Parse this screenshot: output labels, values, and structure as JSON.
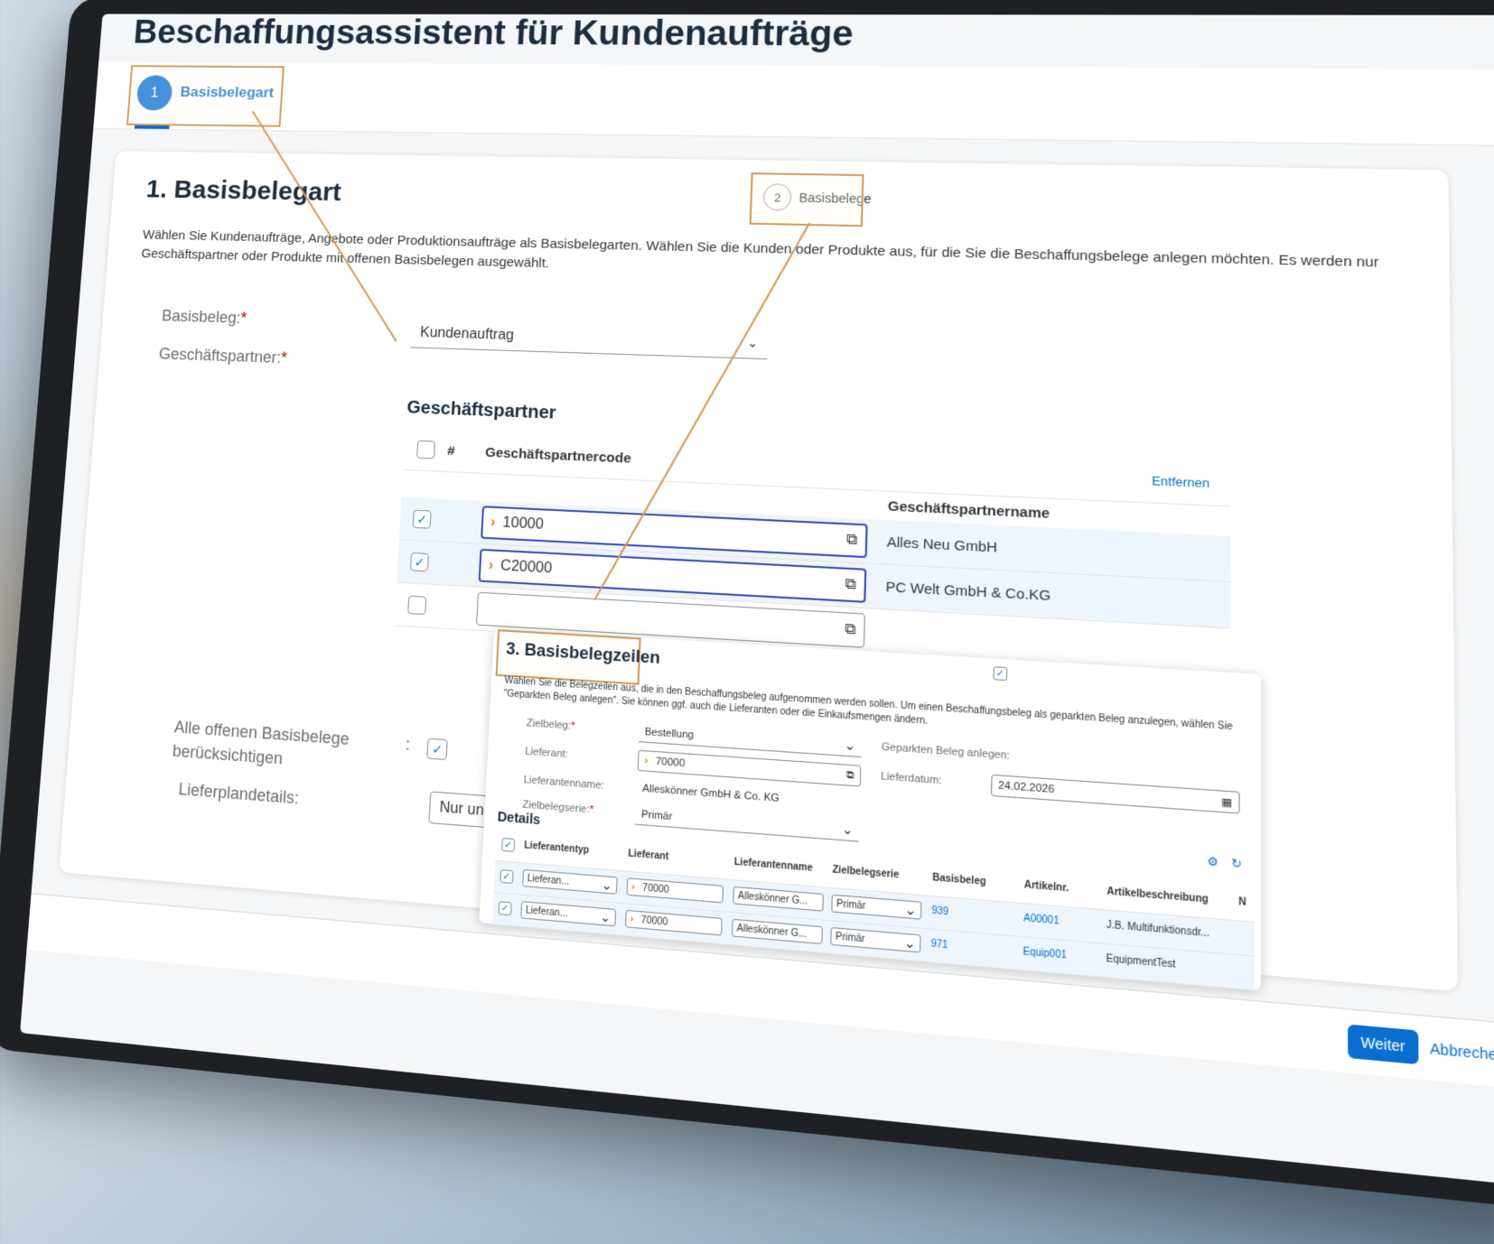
{
  "page": {
    "title": "Beschaffungsassistent für Kundenaufträge"
  },
  "wizard": {
    "step1": {
      "number": "1",
      "label": "Basisbelegart"
    },
    "step2": {
      "number": "2",
      "label": "Basisbelege"
    }
  },
  "section": {
    "title": "1. Basisbelegart",
    "description": "Wählen Sie Kundenaufträge, Angebote oder Produktionsaufträge als Basisbelegarten. Wählen Sie die Kunden oder Produkte aus, für die Sie die Beschaffungsbelege anlegen möchten. Es werden nur Geschäftspartner oder Produkte mit offenen Basisbelegen ausgewählt."
  },
  "form": {
    "basisbeleg_label": "Basisbeleg:",
    "basisbeleg_value": "Kundenauftrag",
    "geschaeftspartner_label": "Geschäftspartner:",
    "required_mark": "*",
    "alle_offenen_label": "Alle offenen Basisbelege berücksichtigen",
    "colon": ":",
    "lieferplan_label": "Lieferplandetails:",
    "lieferplan_value": "Nur unbestäti"
  },
  "partner_table": {
    "title": "Geschäftspartner",
    "hash": "#",
    "col_code": "Geschäftspartnercode",
    "col_name": "Geschäftspartnername",
    "remove_link": "Entfernen",
    "rows": [
      {
        "checked": true,
        "code": "10000",
        "name": "Alles Neu GmbH"
      },
      {
        "checked": true,
        "code": "C20000",
        "name": "PC Welt GmbH & Co.KG"
      },
      {
        "checked": false,
        "code": "",
        "name": ""
      }
    ]
  },
  "step3": {
    "title": "3. Basisbelegzeilen",
    "description": "Wählen Sie die Belegzeilen aus, die in den Beschaffungsbeleg aufgenommen werden sollen. Um einen Beschaffungsbeleg als geparkten Beleg anzulegen, wählen Sie \"Geparkten Beleg anlegen\". Sie können ggf. auch die Lieferanten oder die Einkaufsmengen ändern.",
    "zielbeleg_label": "Zielbeleg:",
    "zielbeleg_value": "Bestellung",
    "geparkt_label": "Geparkten Beleg anlegen:",
    "lieferant_label": "Lieferant:",
    "lieferant_value": "70000",
    "lieferdatum_label": "Lieferdatum:",
    "lieferdatum_value": "24.02.2026",
    "lieferantenname_label": "Lieferantenname:",
    "lieferantenname_value": "Alleskönner GmbH & Co. KG",
    "zielbelegserie_label": "Zielbelegserie:",
    "zielbelegserie_value": "Primär",
    "details_title": "Details",
    "det_headers": [
      "Lieferantentyp",
      "Lieferant",
      "Lieferantenname",
      "Zielbelegserie",
      "Basisbeleg",
      "Artikelnr.",
      "Artikelbeschreibung",
      "N"
    ],
    "det_rows": [
      {
        "typ": "Lieferan...",
        "lieferant": "70000",
        "name": "Alleskönner G...",
        "serie": "Primär",
        "basisbeleg": "939",
        "artikel": "A00001",
        "beschreibung": "J.B. Multifunktionsdr..."
      },
      {
        "typ": "Lieferan...",
        "lieferant": "70000",
        "name": "Alleskönner G...",
        "serie": "Primär",
        "basisbeleg": "971",
        "artikel": "Equip001",
        "beschreibung": "EquipmentTest"
      }
    ]
  },
  "footer": {
    "weiter": "Weiter",
    "abbrechen": "Abbrechen"
  },
  "colors": {
    "accent": "#0a6ed1",
    "callout": "#d69a52",
    "required": "#bb0000",
    "arrow": "#e9730c"
  }
}
